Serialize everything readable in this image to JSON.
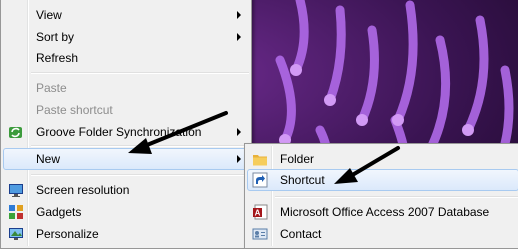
{
  "context_menu": {
    "items": [
      {
        "label": "View",
        "has_submenu": true,
        "enabled": true
      },
      {
        "label": "Sort by",
        "has_submenu": true,
        "enabled": true
      },
      {
        "label": "Refresh",
        "has_submenu": false,
        "enabled": true
      },
      {
        "label": "Paste",
        "has_submenu": false,
        "enabled": false
      },
      {
        "label": "Paste shortcut",
        "has_submenu": false,
        "enabled": false
      },
      {
        "label": "Groove Folder Synchronization",
        "has_submenu": true,
        "enabled": true,
        "icon": "groove-sync-icon"
      },
      {
        "label": "New",
        "has_submenu": true,
        "enabled": true,
        "highlighted": true
      },
      {
        "label": "Screen resolution",
        "has_submenu": false,
        "enabled": true,
        "icon": "monitor-icon"
      },
      {
        "label": "Gadgets",
        "has_submenu": false,
        "enabled": true,
        "icon": "gadgets-icon"
      },
      {
        "label": "Personalize",
        "has_submenu": false,
        "enabled": true,
        "icon": "personalize-icon"
      }
    ]
  },
  "new_submenu": {
    "items": [
      {
        "label": "Folder",
        "icon": "folder-icon"
      },
      {
        "label": "Shortcut",
        "icon": "shortcut-icon",
        "highlighted": true
      },
      {
        "label": "Microsoft Office Access 2007 Database",
        "icon": "access-database-icon"
      },
      {
        "label": "Contact",
        "icon": "contact-icon"
      }
    ]
  },
  "colors": {
    "menu_background": "#f0f0f0",
    "highlight_border": "#a8caf0",
    "disabled_text": "#8d8d8d",
    "wallpaper_accent": "#9b4fd6"
  }
}
